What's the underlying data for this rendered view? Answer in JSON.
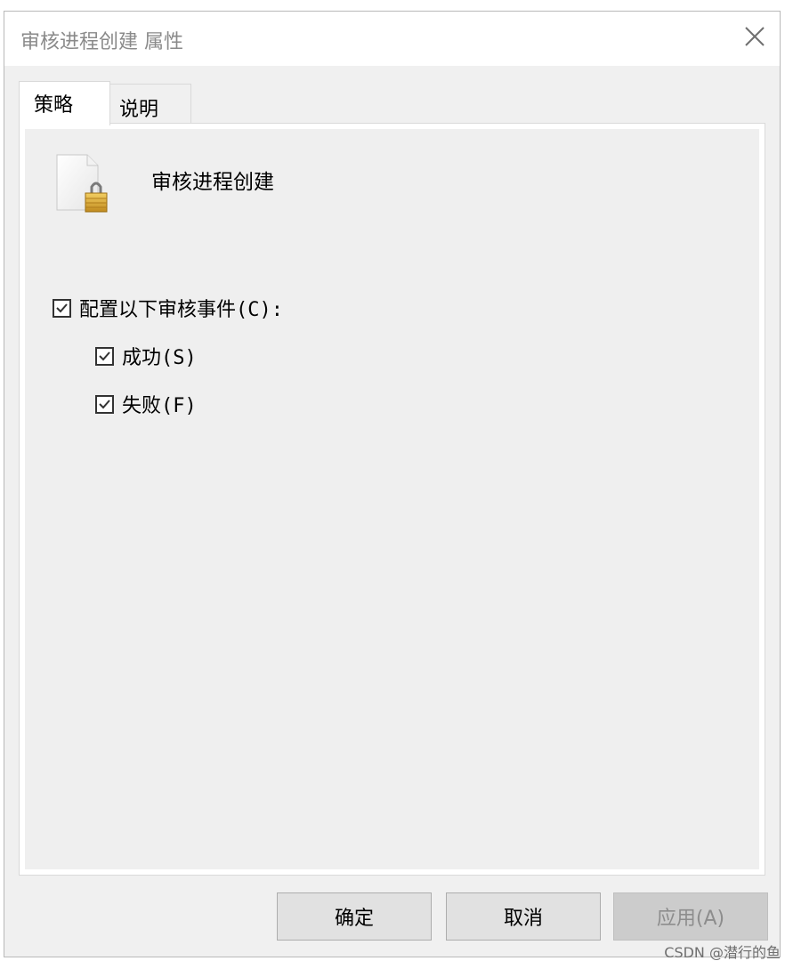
{
  "window": {
    "title": "审核进程创建 属性"
  },
  "tabs": [
    {
      "label": "策略",
      "active": true
    },
    {
      "label": "说明",
      "active": false
    }
  ],
  "policy": {
    "name": "审核进程创建",
    "icon": "policy-file-lock-icon"
  },
  "options": {
    "configure": {
      "label": "配置以下审核事件(C):",
      "checked": true
    },
    "success": {
      "label": "成功(S)",
      "checked": true
    },
    "failure": {
      "label": "失败(F)",
      "checked": true
    }
  },
  "buttons": {
    "ok": "确定",
    "cancel": "取消",
    "apply": "应用(A)",
    "apply_enabled": false
  },
  "watermark": "CSDN @潜行的鱼",
  "colors": {
    "dialog_bg": "#f0f0f0",
    "panel_bg": "#efefef",
    "title_text": "#8a8a8a",
    "disabled_text": "#8d8d8d",
    "lock_gold": "#d7a733"
  }
}
